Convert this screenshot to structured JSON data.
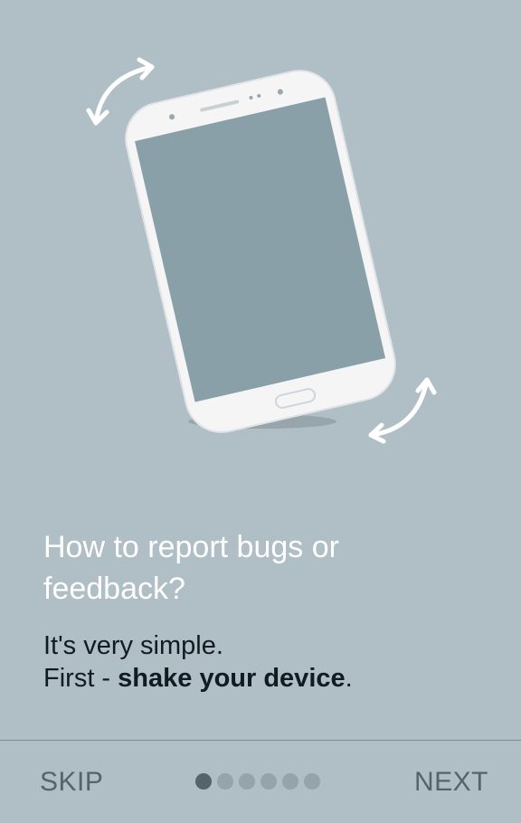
{
  "onboarding": {
    "headline": "How to report bugs or\nfeedback?",
    "body_line1": "It's very simple.",
    "body_line2_prefix": "First - ",
    "body_line2_bold": "shake your device",
    "body_line2_suffix": "."
  },
  "navigation": {
    "skip_label": "SKIP",
    "next_label": "NEXT",
    "page_count": 6,
    "current_page": 1
  },
  "colors": {
    "background": "#b0bec5",
    "phone_body": "#f5f5f5",
    "phone_screen": "#8aa0a9",
    "active_dot": "#55636b",
    "inactive_dot": "#95a4ab"
  },
  "icons": [
    "rotate-arrow-icon",
    "phone-illustration"
  ]
}
